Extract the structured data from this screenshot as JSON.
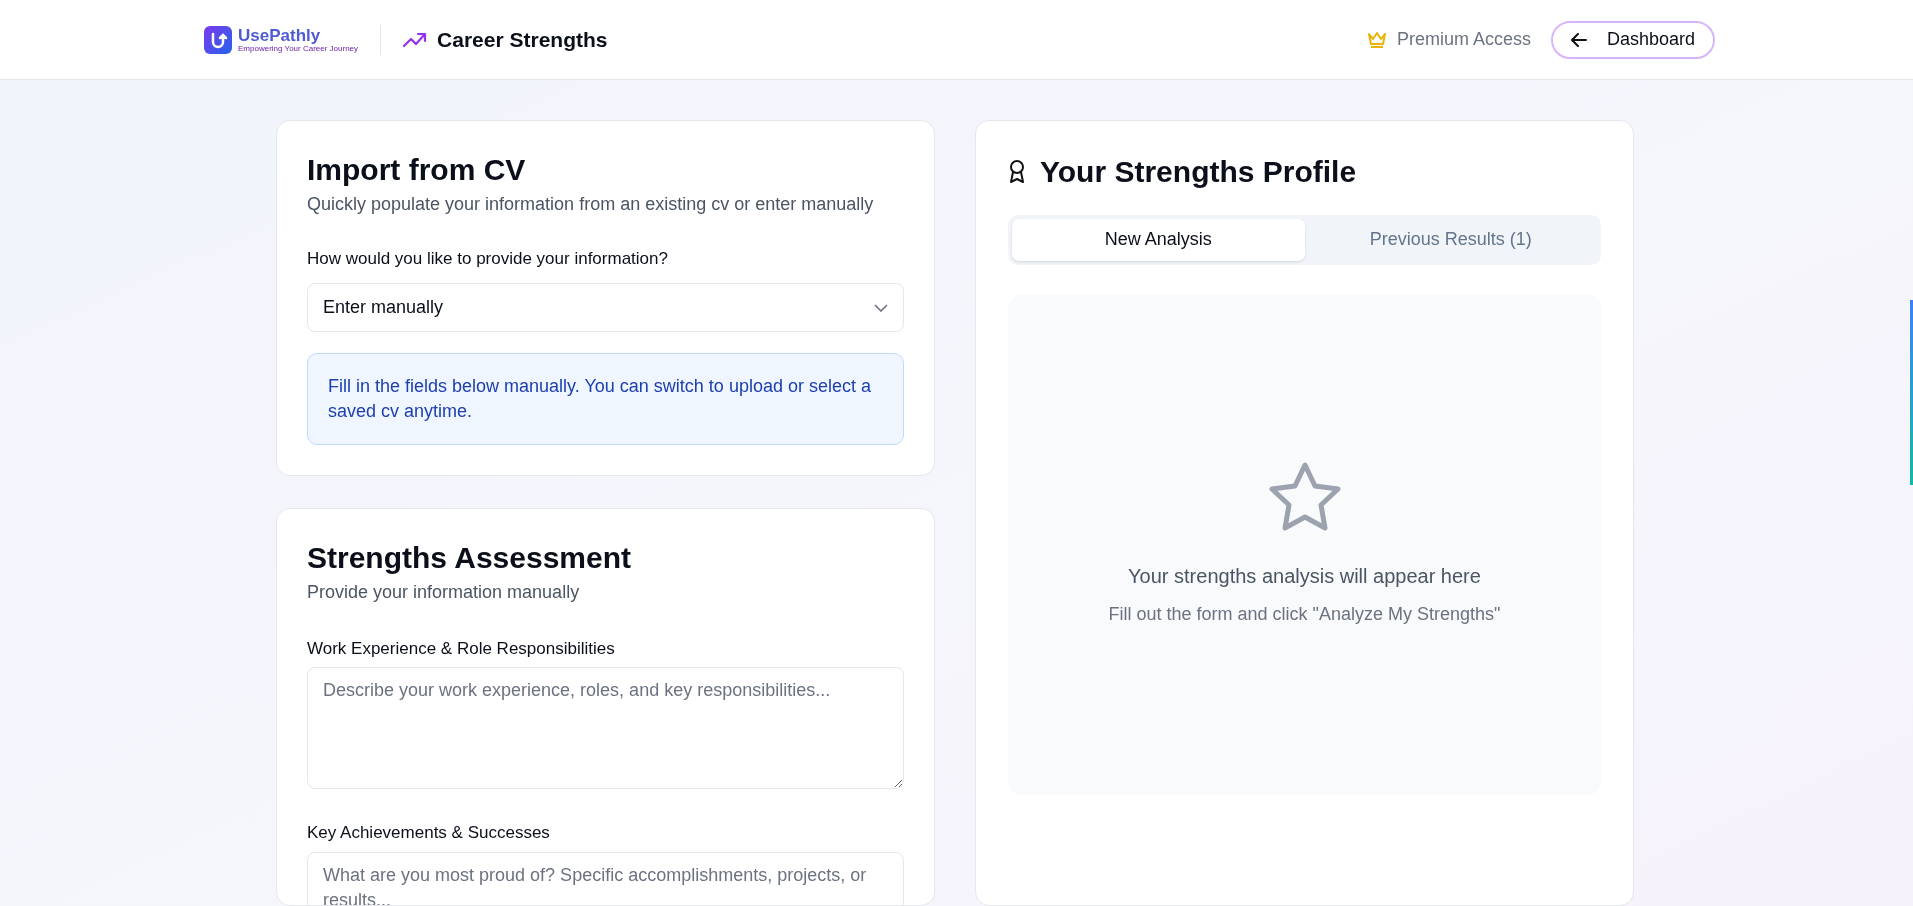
{
  "header": {
    "logo": {
      "name": "UsePathly",
      "tagline": "Empowering Your Career Journey"
    },
    "title": "Career Strengths",
    "premium": "Premium Access",
    "back_button": "Dashboard"
  },
  "import_card": {
    "title": "Import from CV",
    "subtitle": "Quickly populate your information from an existing cv or enter manually",
    "question": "How would you like to provide your information?",
    "select_value": "Enter manually",
    "info": "Fill in the fields below manually. You can switch to upload or select a saved cv anytime."
  },
  "assessment_card": {
    "title": "Strengths Assessment",
    "subtitle": "Provide your information manually",
    "fields": [
      {
        "label": "Work Experience & Role Responsibilities",
        "placeholder": "Describe your work experience, roles, and key responsibilities..."
      },
      {
        "label": "Key Achievements & Successes",
        "placeholder": "What are you most proud of? Specific accomplishments, projects, or results..."
      }
    ]
  },
  "profile_card": {
    "title": "Your Strengths Profile",
    "tabs": [
      {
        "label": "New Analysis",
        "selected": true
      },
      {
        "label": "Previous Results (1)",
        "selected": false
      }
    ],
    "empty_title": "Your strengths analysis will appear here",
    "empty_hint": "Fill out the form and click \"Analyze My Strengths\""
  }
}
